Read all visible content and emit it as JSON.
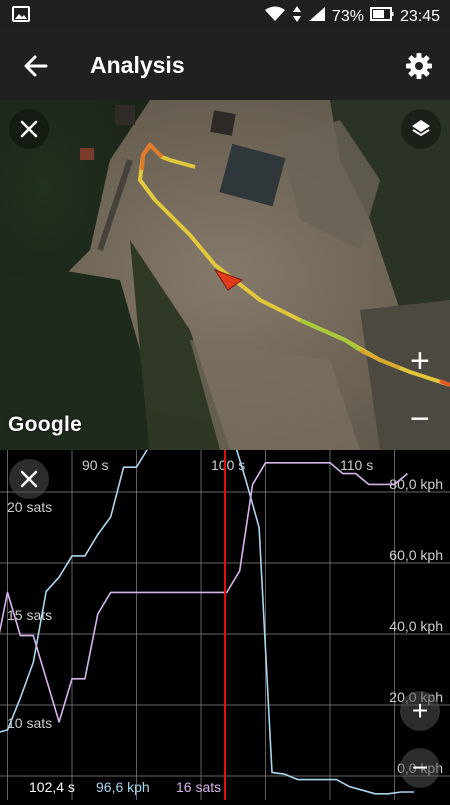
{
  "status_bar": {
    "battery": "73%",
    "time": "23:45",
    "icons": [
      "image-icon",
      "wifi-icon",
      "data-arrows-icon",
      "signal-icon",
      "battery-icon"
    ]
  },
  "app_bar": {
    "title": "Analysis",
    "back_icon": "arrow-back-icon",
    "settings_icon": "gear-icon"
  },
  "map": {
    "attribution": "Google",
    "close_icon": "close-icon",
    "layers_icon": "layers-icon",
    "zoom_in": "+",
    "zoom_out": "−"
  },
  "chart_panel": {
    "close_icon": "close-icon",
    "zoom_in": "+",
    "zoom_out": "−"
  },
  "chart_data": {
    "type": "line",
    "x_ticks": [
      "90 s",
      "100 s",
      "110 s"
    ],
    "left_axis_ticks": [
      "20 sats",
      "15 sats",
      "10 sats"
    ],
    "right_axis_ticks": [
      "80,0 kph",
      "60,0 kph",
      "40,0 kph",
      "20,0 kph",
      "0,0 kph"
    ],
    "cursor": {
      "time": "102,4 s",
      "speed": "96,6 kph",
      "sats": "16 sats"
    },
    "series": [
      {
        "unit": "kph",
        "color": "#a9d7ef",
        "x": [
          80.0,
          81.0,
          82.0,
          83.0,
          84.0,
          85.0,
          86.0,
          87.0,
          88.0,
          89.0,
          90.0,
          91.0,
          92.0,
          93.0,
          94.0,
          95.0,
          96.0,
          97.0,
          98.0,
          99.0,
          99.7,
          100.5,
          101.5,
          102.5,
          103.5,
          104.5,
          105.5,
          106.5,
          107.5,
          108.5,
          109.5,
          110.5,
          111.5,
          112.5,
          113.5,
          114.5,
          115.5,
          116.5
        ],
        "values": [
          0.5,
          2,
          5,
          10,
          12,
          13,
          22,
          32,
          52,
          56,
          62,
          62,
          68,
          73,
          87,
          87,
          93,
          96,
          98,
          100,
          100,
          99,
          97,
          95,
          83,
          70,
          1,
          0.5,
          -1,
          -1,
          -1,
          -1,
          -3,
          -4,
          -5,
          -5,
          -4.5,
          -4.5
        ]
      },
      {
        "unit": "sats",
        "color": "#d8b4ec",
        "x": [
          80.0,
          81.0,
          82.0,
          83.0,
          84.0,
          85.0,
          86.0,
          87.0,
          88.0,
          89.0,
          90.0,
          91.0,
          92.0,
          93.0,
          94.0,
          95.0,
          96.0,
          97.0,
          98.0,
          99.0,
          100.0,
          101.0,
          102.0,
          103.0,
          104.0,
          105.0,
          106.0,
          107.0,
          108.0,
          109.0,
          110.0,
          111.0,
          112.0,
          113.0,
          114.0,
          115.0,
          116.0
        ],
        "values": [
          12,
          12,
          13,
          10,
          13,
          16,
          14,
          14,
          12,
          10,
          12,
          12,
          15,
          16,
          16,
          16,
          16,
          16,
          16,
          16,
          16,
          16,
          16,
          17,
          21,
          22,
          22,
          22,
          22,
          22,
          22,
          21.5,
          21.5,
          21,
          21,
          21,
          21.5
        ]
      }
    ]
  }
}
